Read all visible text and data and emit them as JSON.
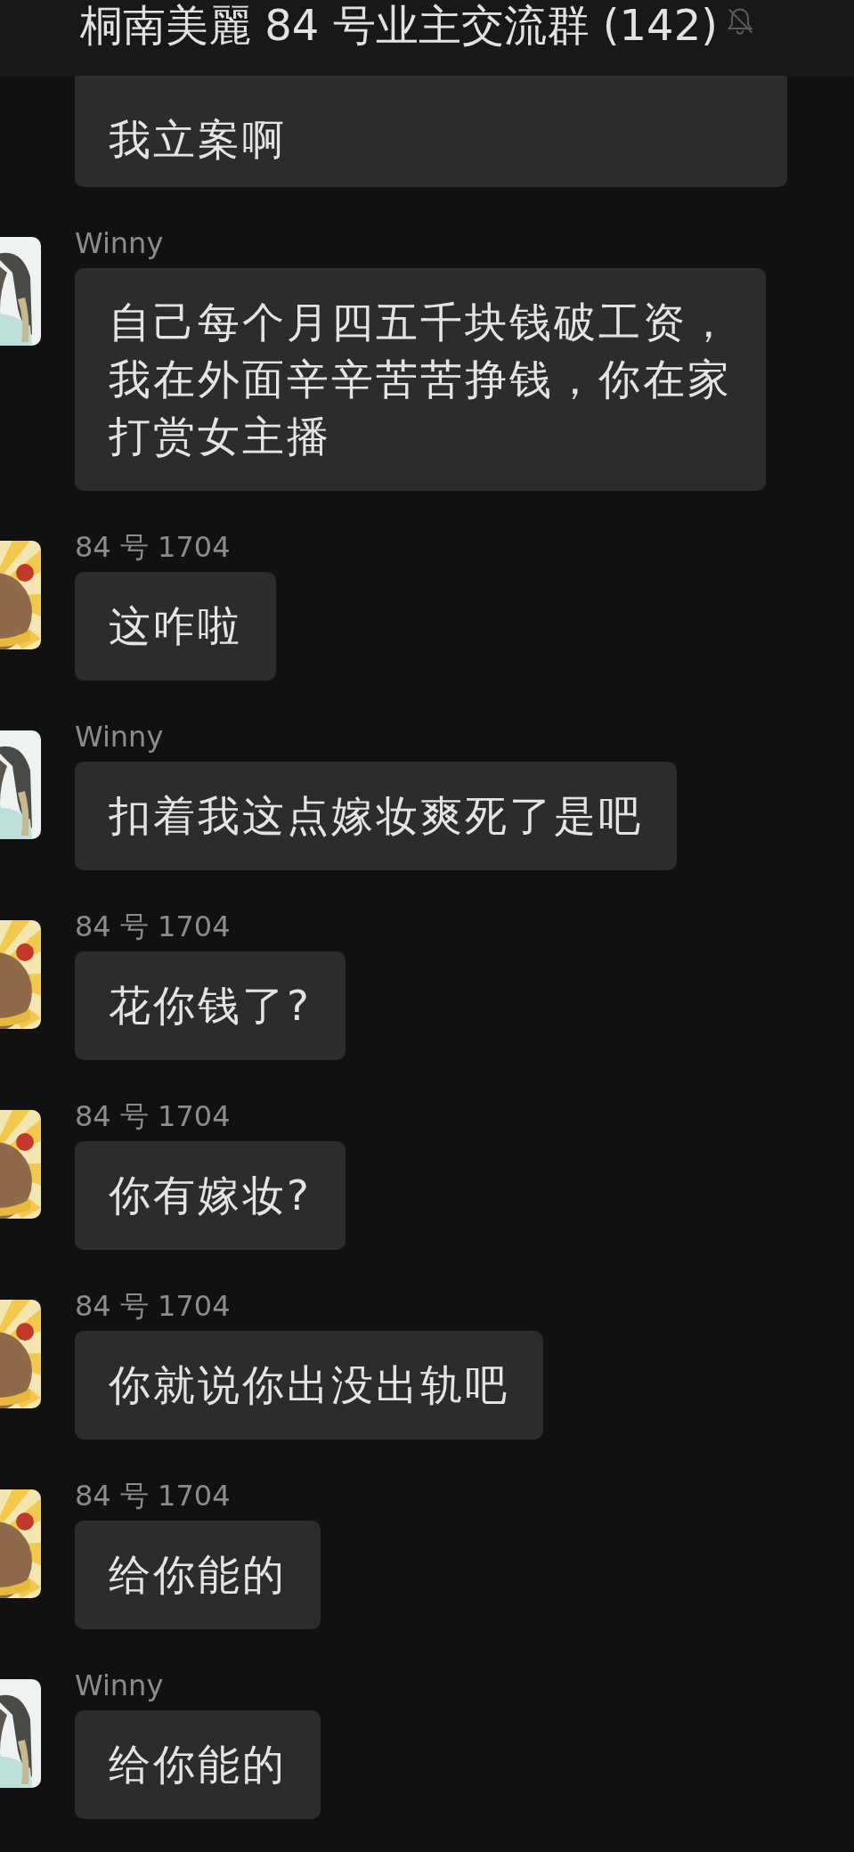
{
  "header": {
    "title": "桐南美麗 84 号业主交流群 (142)",
    "muted": true
  },
  "messages": [
    {
      "kind": "plain",
      "lines": [
        "我立案啊"
      ]
    },
    {
      "sender": "Winny",
      "kind": "girl",
      "lines": [
        "自己每个月四五千块钱破工资，",
        "我在外面辛辛苦苦挣钱，你在家",
        "打赏女主播"
      ]
    },
    {
      "sender": "84 号 1704",
      "kind": "bear",
      "lines": [
        "这咋啦"
      ]
    },
    {
      "sender": "Winny",
      "kind": "girl",
      "lines": [
        "扣着我这点嫁妆爽死了是吧"
      ]
    },
    {
      "sender": "84 号 1704",
      "kind": "bear",
      "lines": [
        "花你钱了?"
      ]
    },
    {
      "sender": "84 号 1704",
      "kind": "bear",
      "lines": [
        "你有嫁妆?"
      ]
    },
    {
      "sender": "84 号 1704",
      "kind": "bear",
      "lines": [
        "你就说你出没出轨吧"
      ]
    },
    {
      "sender": "84 号 1704",
      "kind": "bear",
      "lines": [
        "给你能的"
      ]
    },
    {
      "sender": "Winny",
      "kind": "girl",
      "lines": [
        "给你能的"
      ]
    }
  ]
}
